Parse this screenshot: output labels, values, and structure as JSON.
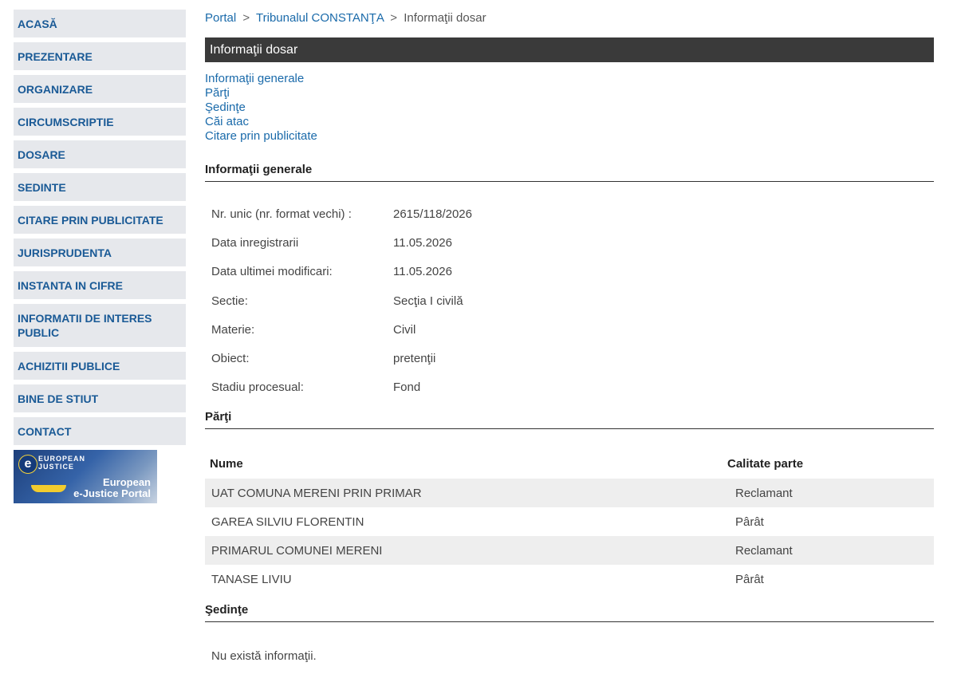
{
  "sidebar": {
    "items": [
      {
        "label": "ACASĂ"
      },
      {
        "label": "PREZENTARE"
      },
      {
        "label": "ORGANIZARE"
      },
      {
        "label": "CIRCUMSCRIPTIE"
      },
      {
        "label": "DOSARE"
      },
      {
        "label": "SEDINTE"
      },
      {
        "label": "CITARE PRIN PUBLICITATE"
      },
      {
        "label": "JURISPRUDENTA"
      },
      {
        "label": "INSTANTA IN CIFRE"
      },
      {
        "label": "INFORMATII DE INTERES PUBLIC"
      },
      {
        "label": "ACHIZITII PUBLICE"
      },
      {
        "label": "BINE DE STIUT"
      },
      {
        "label": "CONTACT"
      }
    ],
    "ejustice": {
      "logo_letter": "e",
      "small_line1": "EUROPEAN",
      "small_line2": "JUSTICE",
      "title_line1": "European",
      "title_line2": "e-Justice Portal"
    }
  },
  "breadcrumb": {
    "portal": "Portal",
    "sep1": ">",
    "court": "Tribunalul CONSTANŢA",
    "sep2": ">",
    "current": "Informaţii dosar"
  },
  "header": {
    "title": "Informaţii dosar"
  },
  "quick_links": [
    {
      "label": "Informaţii generale"
    },
    {
      "label": "Părţi"
    },
    {
      "label": "Şedinţe"
    },
    {
      "label": "Căi atac"
    },
    {
      "label": "Citare prin publicitate"
    }
  ],
  "general": {
    "title": "Informaţii generale",
    "rows": [
      {
        "label": "Nr. unic (nr. format vechi) :",
        "value": "2615/118/2026"
      },
      {
        "label": "Data inregistrarii",
        "value": "11.05.2026"
      },
      {
        "label": "Data ultimei modificari:",
        "value": "11.05.2026"
      },
      {
        "label": "Sectie:",
        "value": "Secţia I civilă"
      },
      {
        "label": "Materie:",
        "value": "Civil"
      },
      {
        "label": "Obiect:",
        "value": "pretenţii"
      },
      {
        "label": "Stadiu procesual:",
        "value": "Fond"
      }
    ]
  },
  "parties": {
    "title": "Părţi",
    "col_name": "Nume",
    "col_role": "Calitate parte",
    "rows": [
      {
        "name": "UAT COMUNA MERENI PRIN PRIMAR",
        "role": "Reclamant"
      },
      {
        "name": "GAREA SILVIU FLORENTIN",
        "role": "Pârât"
      },
      {
        "name": "PRIMARUL COMUNEI MERENI",
        "role": "Reclamant"
      },
      {
        "name": "TANASE LIVIU",
        "role": "Pârât"
      }
    ]
  },
  "hearings": {
    "title": "Şedinţe",
    "empty_text": "Nu există informaţii."
  }
}
